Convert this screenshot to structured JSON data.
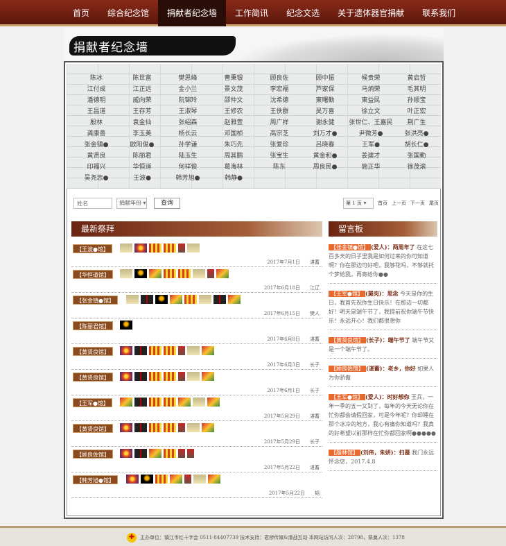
{
  "nav": [
    "首页",
    "综合纪念馆",
    "捐献者纪念墙",
    "工作简讯",
    "纪念文选",
    "关于遗体器官捐献",
    "联系我们"
  ],
  "nav_active": 2,
  "banner_title": "捐献者纪念墙",
  "wall_names": [
    "陈冰",
    "陈世富",
    "樊思峰",
    "曹秉银",
    "顾良佐",
    "顾中振",
    "候贵荣",
    "黄启哲",
    "江付成",
    "江正远",
    "金小兰",
    "景文茂",
    "李宏福",
    "芦家保",
    "马炳荣",
    "毛其明",
    "潘德明",
    "戚向荣",
    "阮锦玲",
    "邵仲文",
    "沈希德",
    "東曙勤",
    "東益民",
    "孙顺宝",
    "王昌道",
    "王存芳",
    "王淑琴",
    "王修农",
    "王佚群",
    "吴万喜",
    "徐立文",
    "叶正宏",
    "殷林",
    "袁金仙",
    "张绍森",
    "赵雅萱",
    "周广祥",
    "谢永健",
    "张世仁、王嘉民",
    "荆广生",
    "龚康善",
    "李玉美",
    "杨长云",
    "邓国桢",
    "高宗芝",
    "刘万才●",
    "尹微芳●",
    "张洪亮●",
    "张金镇●",
    "欧阳俊●",
    "孙学谦",
    "朱巧先",
    "张爱珍",
    "吕晓春",
    "王军●",
    "胡长仁●",
    "黄贤良",
    "陈丽君",
    "陆玉生",
    "周其鹏",
    "张宝生",
    "黄金和●",
    "姜建才",
    "张国勤",
    "印福兴",
    "华恒道",
    "何祥俊",
    "葛海林",
    "陈东",
    "周良民●",
    "施正华",
    "徐茂滚",
    "吴尧忠●",
    "王波●",
    "韩芳旭●",
    "韩静●"
  ],
  "search": {
    "placeholder": "姓名",
    "year_select": "捐献年份",
    "button": "查询"
  },
  "pager": {
    "page_select": "第 1 页",
    "first": "首页",
    "prev": "上一页",
    "next": "下一页",
    "last": "尾页"
  },
  "left_title": "最新祭拜",
  "right_title": "留言板",
  "offerings": [
    {
      "hall": "【王波●馆】",
      "items": [
        "tea",
        "flower",
        "paper",
        "paper",
        "wine",
        "tea"
      ],
      "date": "2017年7月1日",
      "by": "湛蓄"
    },
    {
      "hall": "【华恒道馆】",
      "items": [
        "tea",
        "candle",
        "fruit",
        "paper",
        "paper",
        "tea",
        "wine",
        "fruit"
      ],
      "date": "2017年6月18日",
      "by": "江辽"
    },
    {
      "hall": "【张金镇●馆】",
      "items": [
        "tea",
        "incense",
        "candle",
        "fruit",
        "paper",
        "tea",
        "incense",
        "fruit"
      ],
      "date": "2017年6月15日",
      "by": "樊人"
    },
    {
      "hall": "【陈丽君馆】",
      "items": [
        "candle"
      ],
      "date": "2017年6月8日",
      "by": "湛蓄"
    },
    {
      "hall": "【黄贤良馆】",
      "items": [
        "flower",
        "incense",
        "paper",
        "paper",
        "wine",
        "tea",
        "fruit"
      ],
      "date": "2017年6月3日",
      "by": "长子"
    },
    {
      "hall": "【黄贤良馆】",
      "items": [
        "flower",
        "incense",
        "paper",
        "paper",
        "wine",
        "tea",
        "fruit"
      ],
      "date": "2017年6月1日",
      "by": "长子"
    },
    {
      "hall": "【王军●馆】",
      "items": [
        "fruit",
        "incense",
        "paper",
        "paper",
        "fruit",
        "tea",
        "fruit"
      ],
      "date": "2017年5月29日",
      "by": "湛蓄"
    },
    {
      "hall": "【黄贤良馆】",
      "items": [
        "flower",
        "incense",
        "paper",
        "paper",
        "wine",
        "tea",
        "fruit"
      ],
      "date": "2017年5月29日",
      "by": "长子"
    },
    {
      "hall": "【顾良佐馆】",
      "items": [
        "flower",
        "incense",
        "fruit",
        "paper",
        "wine",
        "wine"
      ],
      "date": "2017年5月22日",
      "by": "湛蓄"
    },
    {
      "hall": "【韩芳旭●馆】",
      "items": [
        "flower",
        "candle",
        "paper",
        "fruit",
        "wine",
        "tea",
        "fruit"
      ],
      "date": "2017年5月22日",
      "by": "韬"
    }
  ],
  "messages": [
    {
      "hall": "【张金镇●馆】",
      "who": "(爱人)：",
      "title": "两周年了",
      "body": "在这七百多天的日子里我是如何过来的你可知道啊？你在那边可好吧，我够花吗，不够就托个梦给我，再寄给你●●"
    },
    {
      "hall": "【王军●馆】",
      "who": "(舅肉)：",
      "title": "思念",
      "body": "今天是你的生日，我首先祝你生日快乐！在那边一切都好！明天是端午节了，我提前祝你端午节快乐！永远开心！我们都很想你"
    },
    {
      "hall": "【黄贤良馆】",
      "who": "(长子)：",
      "title": "端午节了",
      "body": "端午节又是一个端午节了。"
    },
    {
      "hall": "【顾良佐馆】",
      "who": "(湛蓄)：",
      "title": "老乡，你好",
      "body": "如果人为你骄傲"
    },
    {
      "hall": "【王军●馆】",
      "who": "(爱人)：",
      "title": "时好想你",
      "body": "王兵，一年一季的五一又到了，每年的今天无论你在忙你都会请假回家，可是今年呢？你却睡在那个冰冷的地方，我心有痛你知道吗？我真的好希望以前那样在忙你都回家啊●●●●●"
    },
    {
      "hall": "【殷林馆】",
      "who": "(刘伟，朱妍)：",
      "title": "扫墓",
      "body": "我门永远怀念您，2017.4.8"
    }
  ],
  "footer": "主办单位：镇江市红十字会 0511-84407739 技术支持：君桥传媒&濠战互动 本网站访问人次：28798，祭奠人次：1378"
}
